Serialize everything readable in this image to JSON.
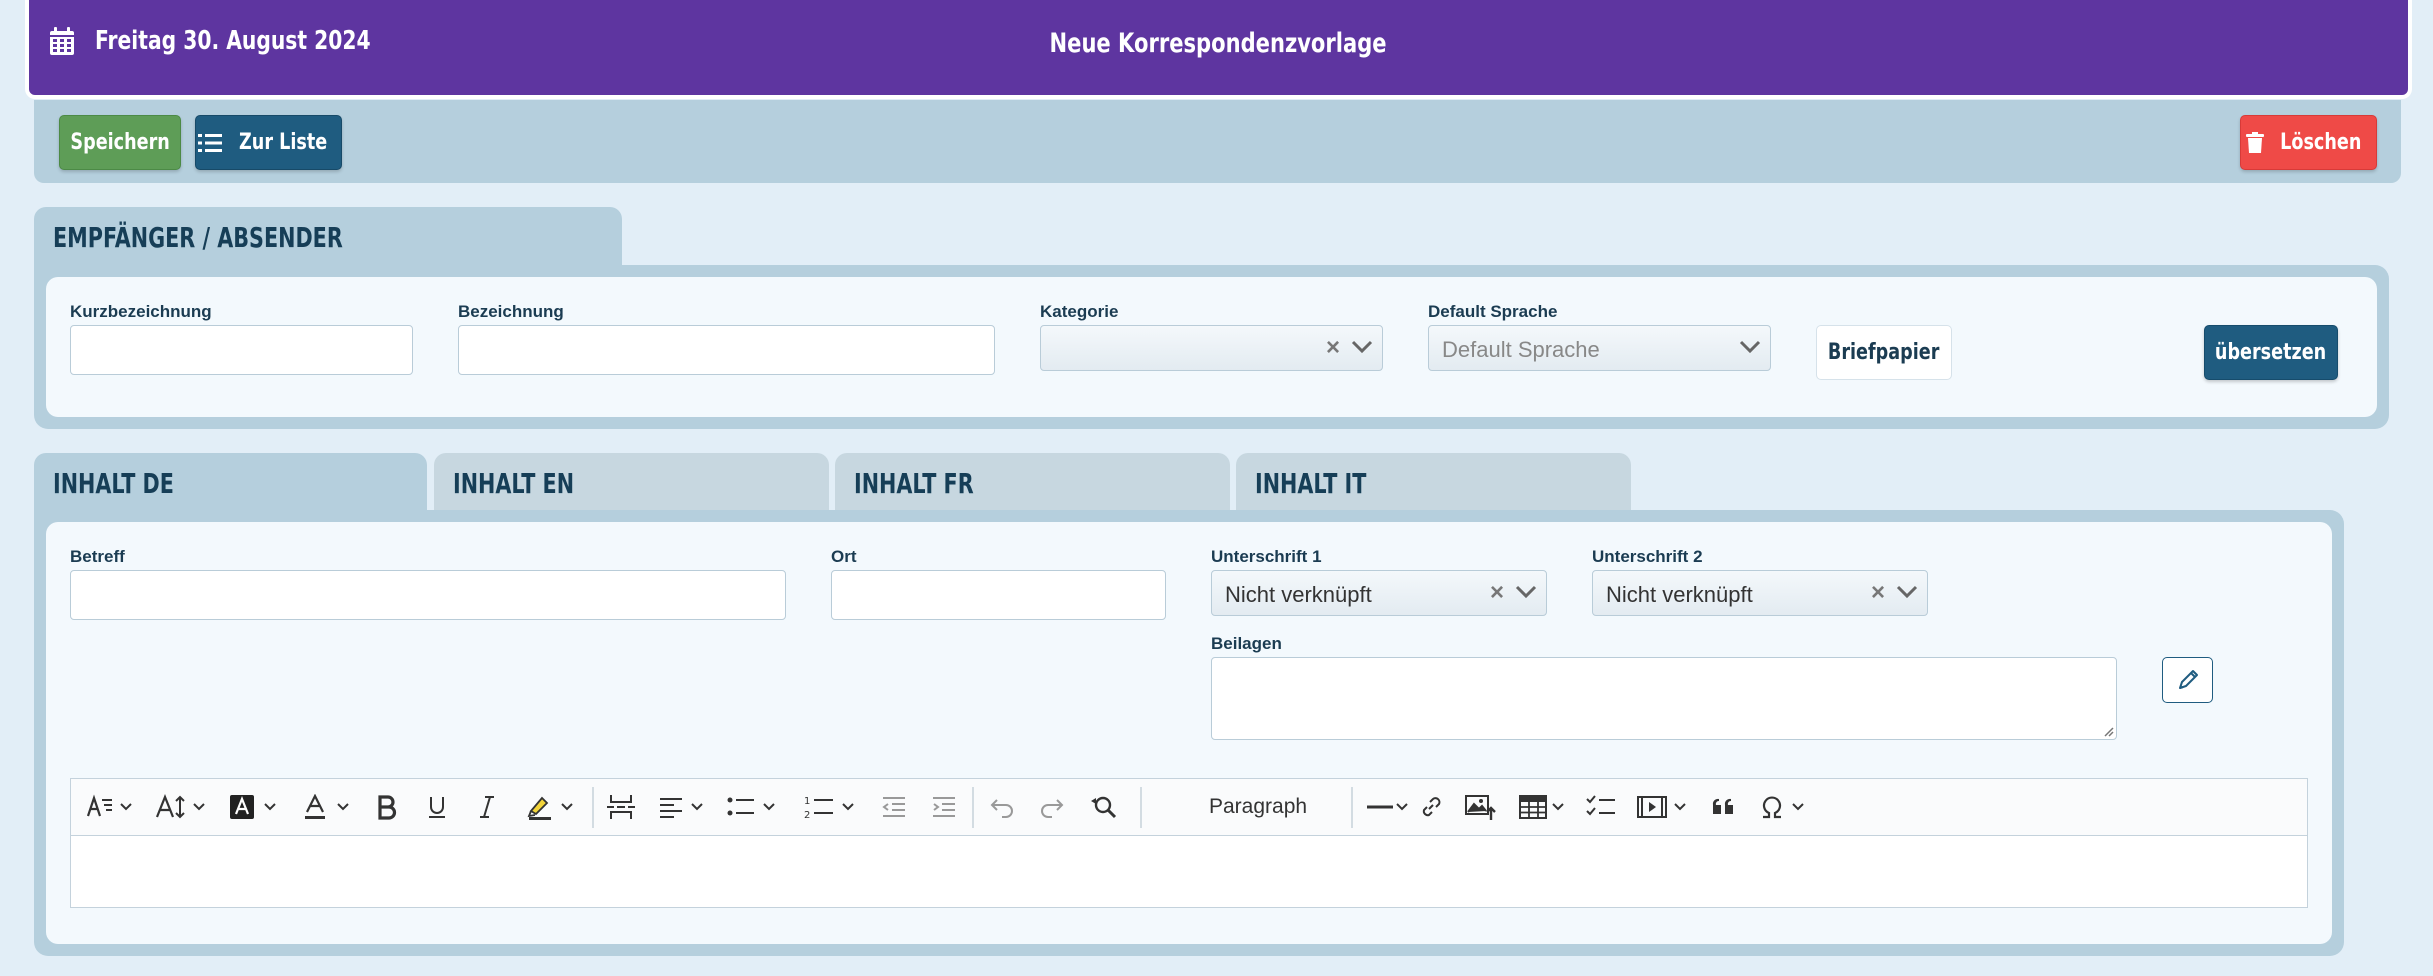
{
  "header": {
    "date": "Freitag 30. August 2024",
    "title": "Neue Korrespondenzvorlage",
    "calendar_icon": "calendar-icon"
  },
  "toolbar": {
    "save_label": "Speichern",
    "list_label": "Zur Liste",
    "delete_label": "Löschen"
  },
  "recipient_section": {
    "tab_label": "EMPFÄNGER / ABSENDER",
    "kurzbezeichnung": {
      "label": "Kurzbezeichnung",
      "value": ""
    },
    "bezeichnung": {
      "label": "Bezeichnung",
      "value": ""
    },
    "kategorie": {
      "label": "Kategorie",
      "value": ""
    },
    "default_sprache": {
      "label": "Default Sprache",
      "placeholder": "Default Sprache"
    },
    "briefpapier_label": "Briefpapier",
    "translate_label": "übersetzen"
  },
  "content_tabs": [
    {
      "label": "INHALT DE",
      "active": true
    },
    {
      "label": "INHALT EN",
      "active": false
    },
    {
      "label": "INHALT FR",
      "active": false
    },
    {
      "label": "INHALT IT",
      "active": false
    }
  ],
  "content": {
    "betreff": {
      "label": "Betreff",
      "value": ""
    },
    "ort": {
      "label": "Ort",
      "value": ""
    },
    "unterschrift1": {
      "label": "Unterschrift 1",
      "value": "Nicht verknüpft"
    },
    "unterschrift2": {
      "label": "Unterschrift 2",
      "value": "Nicht verknüpft"
    },
    "beilagen": {
      "label": "Beilagen",
      "value": ""
    }
  },
  "editor": {
    "paragraph_label": "Paragraph",
    "body": "",
    "tools": [
      "heading-icon",
      "font-size-icon",
      "font-background-color-icon",
      "font-color-icon",
      "bold-icon",
      "underline-icon",
      "italic-icon",
      "highlight-icon",
      "page-break-icon",
      "align-icon",
      "bulleted-list-icon",
      "numbered-list-icon",
      "outdent-icon",
      "indent-icon",
      "undo-icon",
      "redo-icon",
      "find-replace-icon",
      "horizontal-line-icon",
      "link-icon",
      "image-upload-icon",
      "table-icon",
      "todo-list-icon",
      "media-embed-icon",
      "blockquote-icon",
      "special-characters-icon"
    ]
  },
  "colors": {
    "header_bg": "#5e35a0",
    "save_bg": "#5e9d57",
    "list_bg": "#1f5c80",
    "delete_bg": "#ef4a47",
    "panel_bg": "#b5cfdd",
    "page_bg": "#e2eef7"
  }
}
